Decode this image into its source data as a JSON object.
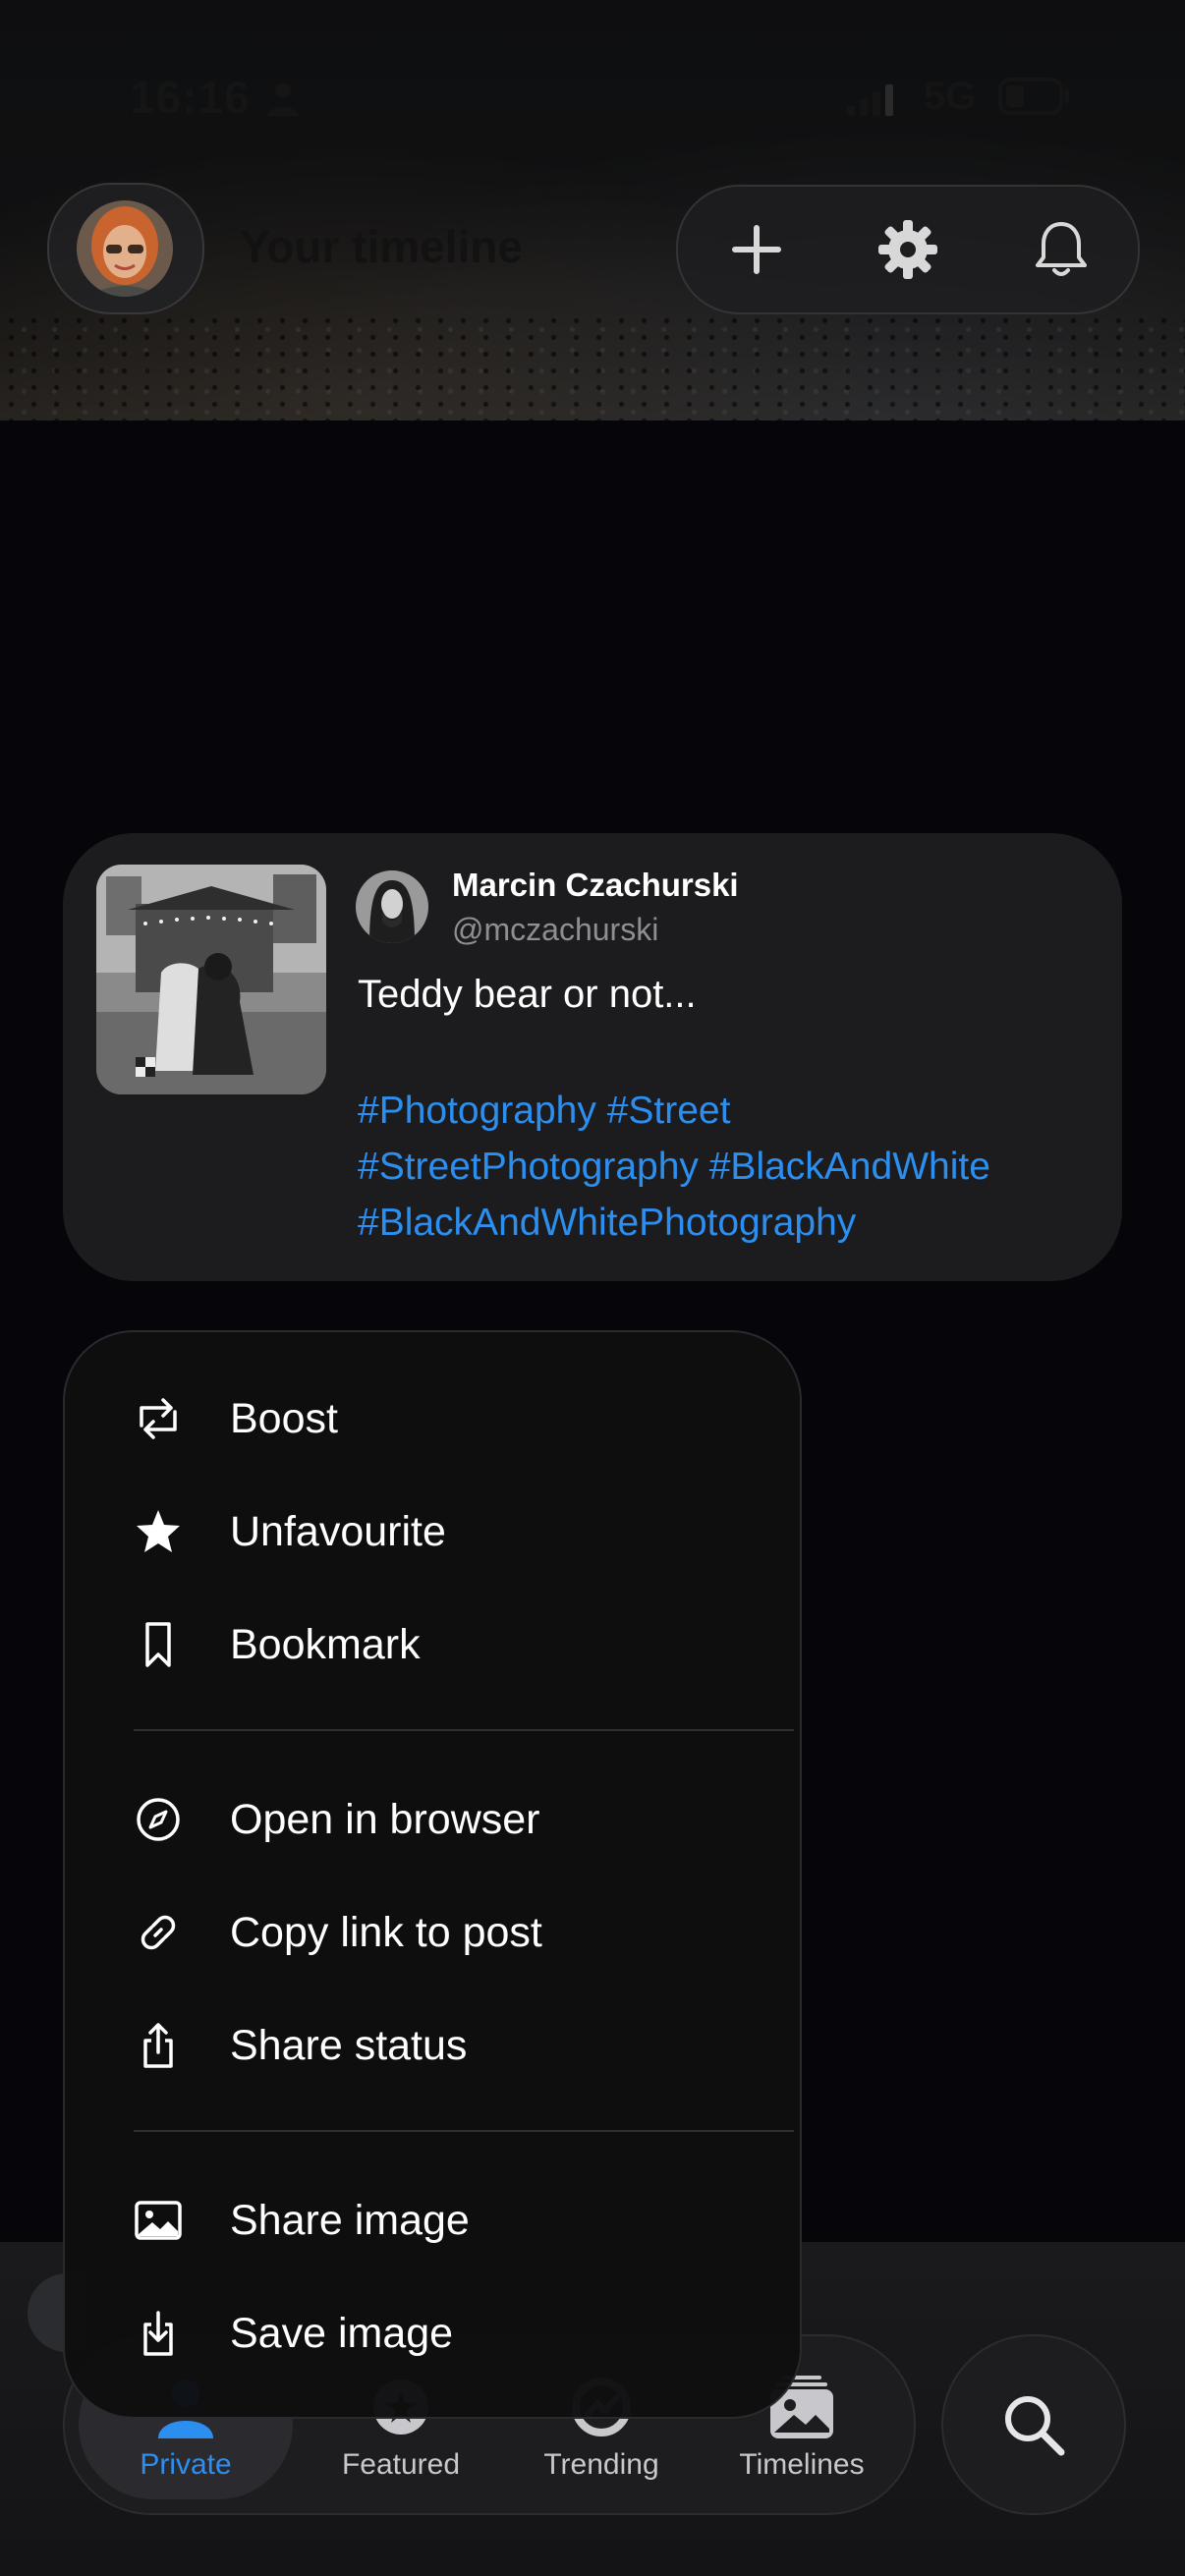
{
  "status_bar": {
    "time": "16:16",
    "network": "5G",
    "icons": [
      "person-icon",
      "signal-icon",
      "battery-icon"
    ]
  },
  "header": {
    "title": "Your timeline",
    "avatar": "user-avatar",
    "actions": [
      "plus-icon",
      "gear-icon",
      "bell-icon"
    ]
  },
  "post": {
    "author_name": "Marcin Czachurski",
    "author_handle": "@mczachurski",
    "text": "Teddy bear or not...",
    "hashtag_lines": [
      "#Photography #Street",
      "#StreetPhotography #BlackAndWhite",
      "#BlackAndWhitePhotography"
    ]
  },
  "menu": {
    "groups": [
      [
        {
          "label": "Boost",
          "icon": "boost-icon"
        },
        {
          "label": "Unfavourite",
          "icon": "star-filled-icon"
        },
        {
          "label": "Bookmark",
          "icon": "bookmark-icon"
        }
      ],
      [
        {
          "label": "Open in browser",
          "icon": "compass-icon"
        },
        {
          "label": "Copy link to post",
          "icon": "link-icon"
        },
        {
          "label": "Share status",
          "icon": "share-icon"
        }
      ],
      [
        {
          "label": "Share image",
          "icon": "photo-icon"
        },
        {
          "label": "Save image",
          "icon": "download-icon"
        }
      ]
    ]
  },
  "tabs": {
    "items": [
      {
        "label": "Private",
        "icon": "person-icon",
        "active": true
      },
      {
        "label": "Featured",
        "icon": "featured-icon",
        "active": false
      },
      {
        "label": "Trending",
        "icon": "trending-icon",
        "active": false
      },
      {
        "label": "Timelines",
        "icon": "photos-stack-icon",
        "active": false
      }
    ],
    "search_icon": "search-icon"
  },
  "colors": {
    "accent": "#2c8ff0",
    "card_bg": "#1c1c1e",
    "menu_bg": "#0e0e10",
    "text_secondary": "#8e8e93"
  }
}
